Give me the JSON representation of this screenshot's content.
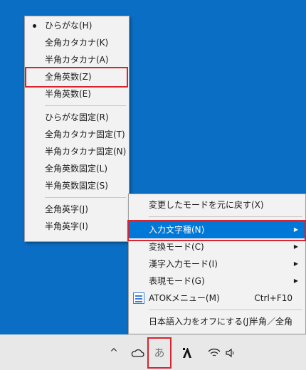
{
  "input_mode_menu": {
    "items": [
      {
        "label": "ひらがな(H)",
        "selected": true
      },
      {
        "label": "全角カタカナ(K)"
      },
      {
        "label": "半角カタカナ(A)"
      },
      {
        "label": "全角英数(Z)",
        "highlighted": true
      },
      {
        "label": "半角英数(E)"
      }
    ],
    "fixed_items": [
      {
        "label": "ひらがな固定(R)"
      },
      {
        "label": "全角カタカナ固定(T)"
      },
      {
        "label": "半角カタカナ固定(N)"
      },
      {
        "label": "全角英数固定(L)"
      },
      {
        "label": "半角英数固定(S)"
      }
    ],
    "char_items": [
      {
        "label": "全角英字(J)"
      },
      {
        "label": "半角英字(I)"
      }
    ]
  },
  "atok_menu": {
    "restore_mode": "変更したモードを元に戻す(X)",
    "input_char_type": "入力文字種(N)",
    "conversion_mode": "変換モード(C)",
    "kanji_input_mode": "漢字入力モード(I)",
    "expression_mode": "表現モード(G)",
    "atok_menu_label": "ATOKメニュー(M)",
    "atok_menu_shortcut": "Ctrl+F10",
    "turn_off_japanese": "日本語入力をオフにする(J)",
    "turn_off_shortcut": "半角／全角"
  },
  "taskbar": {
    "chevron_icon": "^",
    "onedrive_icon": "cloud-icon",
    "ime_mode_char": "あ",
    "atok_logo_char": "A",
    "wifi_icon": "wifi-icon",
    "volume_icon": "speaker-icon"
  },
  "colors": {
    "desktop": "#0a6fc4",
    "menu_bg": "#f2f2f2",
    "selection": "#0078d7",
    "highlight_box": "#d9232e"
  }
}
